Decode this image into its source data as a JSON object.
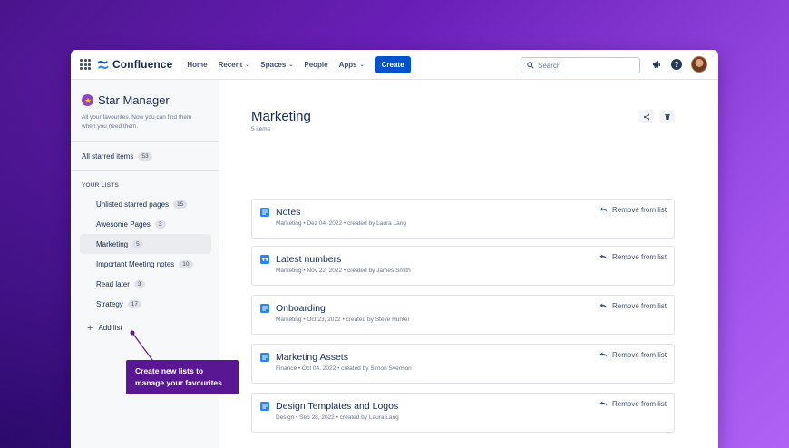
{
  "app": {
    "name": "Confluence",
    "brand_color": "#0052cc"
  },
  "topnav": {
    "items": [
      {
        "label": "Home",
        "dropdown": false
      },
      {
        "label": "Recent",
        "dropdown": true
      },
      {
        "label": "Spaces",
        "dropdown": true
      },
      {
        "label": "People",
        "dropdown": false
      },
      {
        "label": "Apps",
        "dropdown": true
      }
    ],
    "create_label": "Create",
    "search_placeholder": "Search"
  },
  "sidebar": {
    "title": "Star Manager",
    "description": "All your favourites. Now you can find them when you need them.",
    "all_starred": {
      "label": "All starred items",
      "count": "53"
    },
    "section_title": "YOUR LISTS",
    "lists": [
      {
        "label": "Unlisted starred pages",
        "count": "15",
        "active": false
      },
      {
        "label": "Awesome Pages",
        "count": "3",
        "active": false
      },
      {
        "label": "Marketing",
        "count": "5",
        "active": true
      },
      {
        "label": "Important Meeting notes",
        "count": "10",
        "active": false
      },
      {
        "label": "Read later",
        "count": "3",
        "active": false
      },
      {
        "label": "Strategy",
        "count": "17",
        "active": false
      }
    ],
    "add_list_label": "Add list"
  },
  "tooltip": {
    "line1": "Create new lists to",
    "line2": "manage your favourites"
  },
  "main": {
    "title": "Marketing",
    "subtitle": "5 items",
    "remove_label": "Remove from list",
    "cards": [
      {
        "title": "Notes",
        "meta": "Marketing • Dez 04, 2022 • created by Laura Lang",
        "icon": "page-icon"
      },
      {
        "title": "Latest numbers",
        "meta": "Marketing • Nov 22, 2022 • created by James Smith",
        "icon": "quote-icon"
      },
      {
        "title": "Onboarding",
        "meta": "Marketing • Oct 23, 2022 • created by Steve Hunter",
        "icon": "page-icon"
      },
      {
        "title": "Marketing Assets",
        "meta": "Finance • Oct 04, 2022 • created by Simon Svenson",
        "icon": "page-icon"
      },
      {
        "title": "Design Templates and Logos",
        "meta": "Design • Sep 28, 2022 • created by Laura Lang",
        "icon": "page-icon"
      }
    ]
  }
}
